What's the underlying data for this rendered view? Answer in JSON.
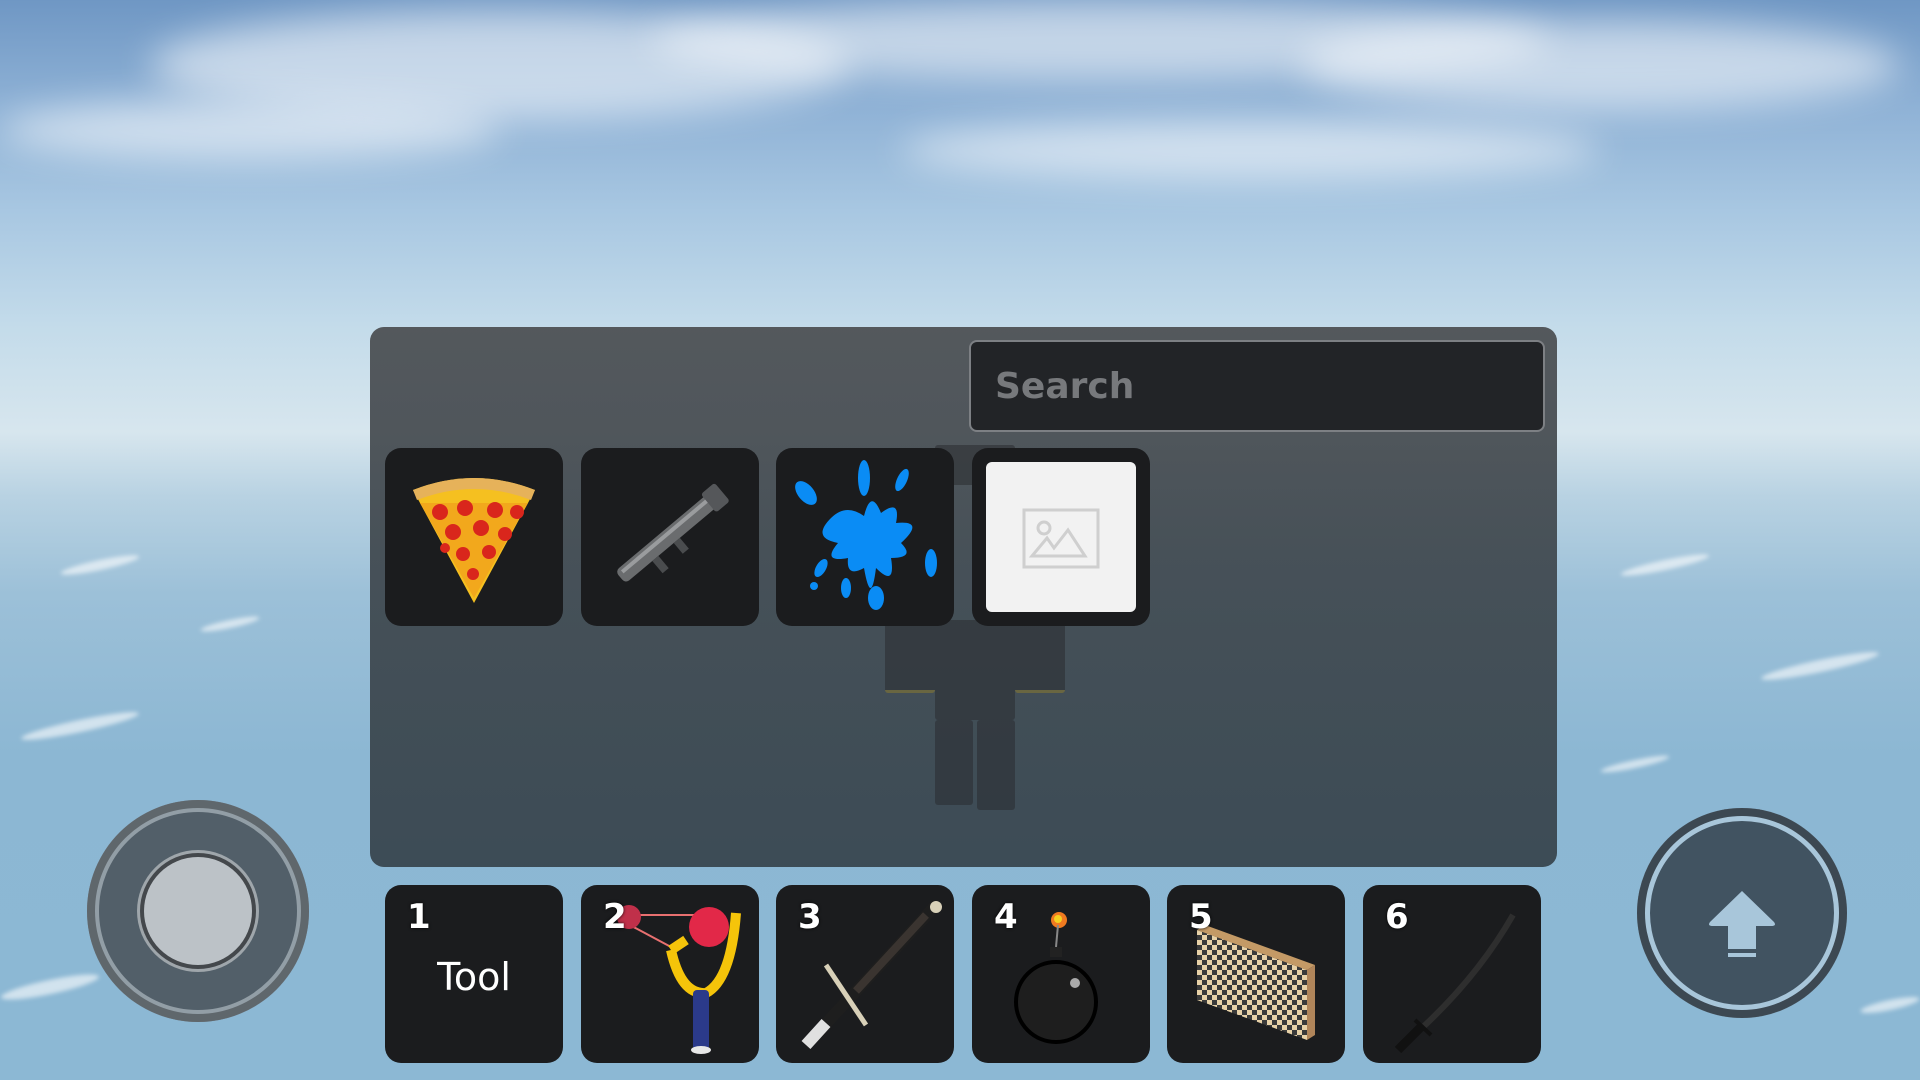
{
  "game": {
    "backpack": {
      "search": {
        "placeholder": "Search",
        "value": ""
      },
      "inventory_items": [
        {
          "name": "Pizza",
          "icon": "pizza-slice-icon"
        },
        {
          "name": "Rocket Launcher",
          "icon": "rocket-launcher-icon"
        },
        {
          "name": "Paint Splat",
          "icon": "blue-splat-icon"
        },
        {
          "name": "Unnamed Item",
          "icon": "image-placeholder-icon"
        }
      ]
    },
    "hotbar": {
      "slots": [
        {
          "number": "1",
          "label": "Tool",
          "icon": ""
        },
        {
          "number": "2",
          "label": "",
          "icon": "slingshot-icon"
        },
        {
          "number": "3",
          "label": "",
          "icon": "sword-icon"
        },
        {
          "number": "4",
          "label": "",
          "icon": "bomb-icon"
        },
        {
          "number": "5",
          "label": "",
          "icon": "wall-icon"
        },
        {
          "number": "6",
          "label": "",
          "icon": "katana-icon"
        }
      ]
    },
    "controls": {
      "joystick": "thumbstick",
      "jump": "jump-button"
    },
    "colors": {
      "slot_bg": "#1b1c1e",
      "panel_bg": "#50545a",
      "search_bg": "#222427",
      "splat_blue": "#0a8cf5"
    }
  }
}
